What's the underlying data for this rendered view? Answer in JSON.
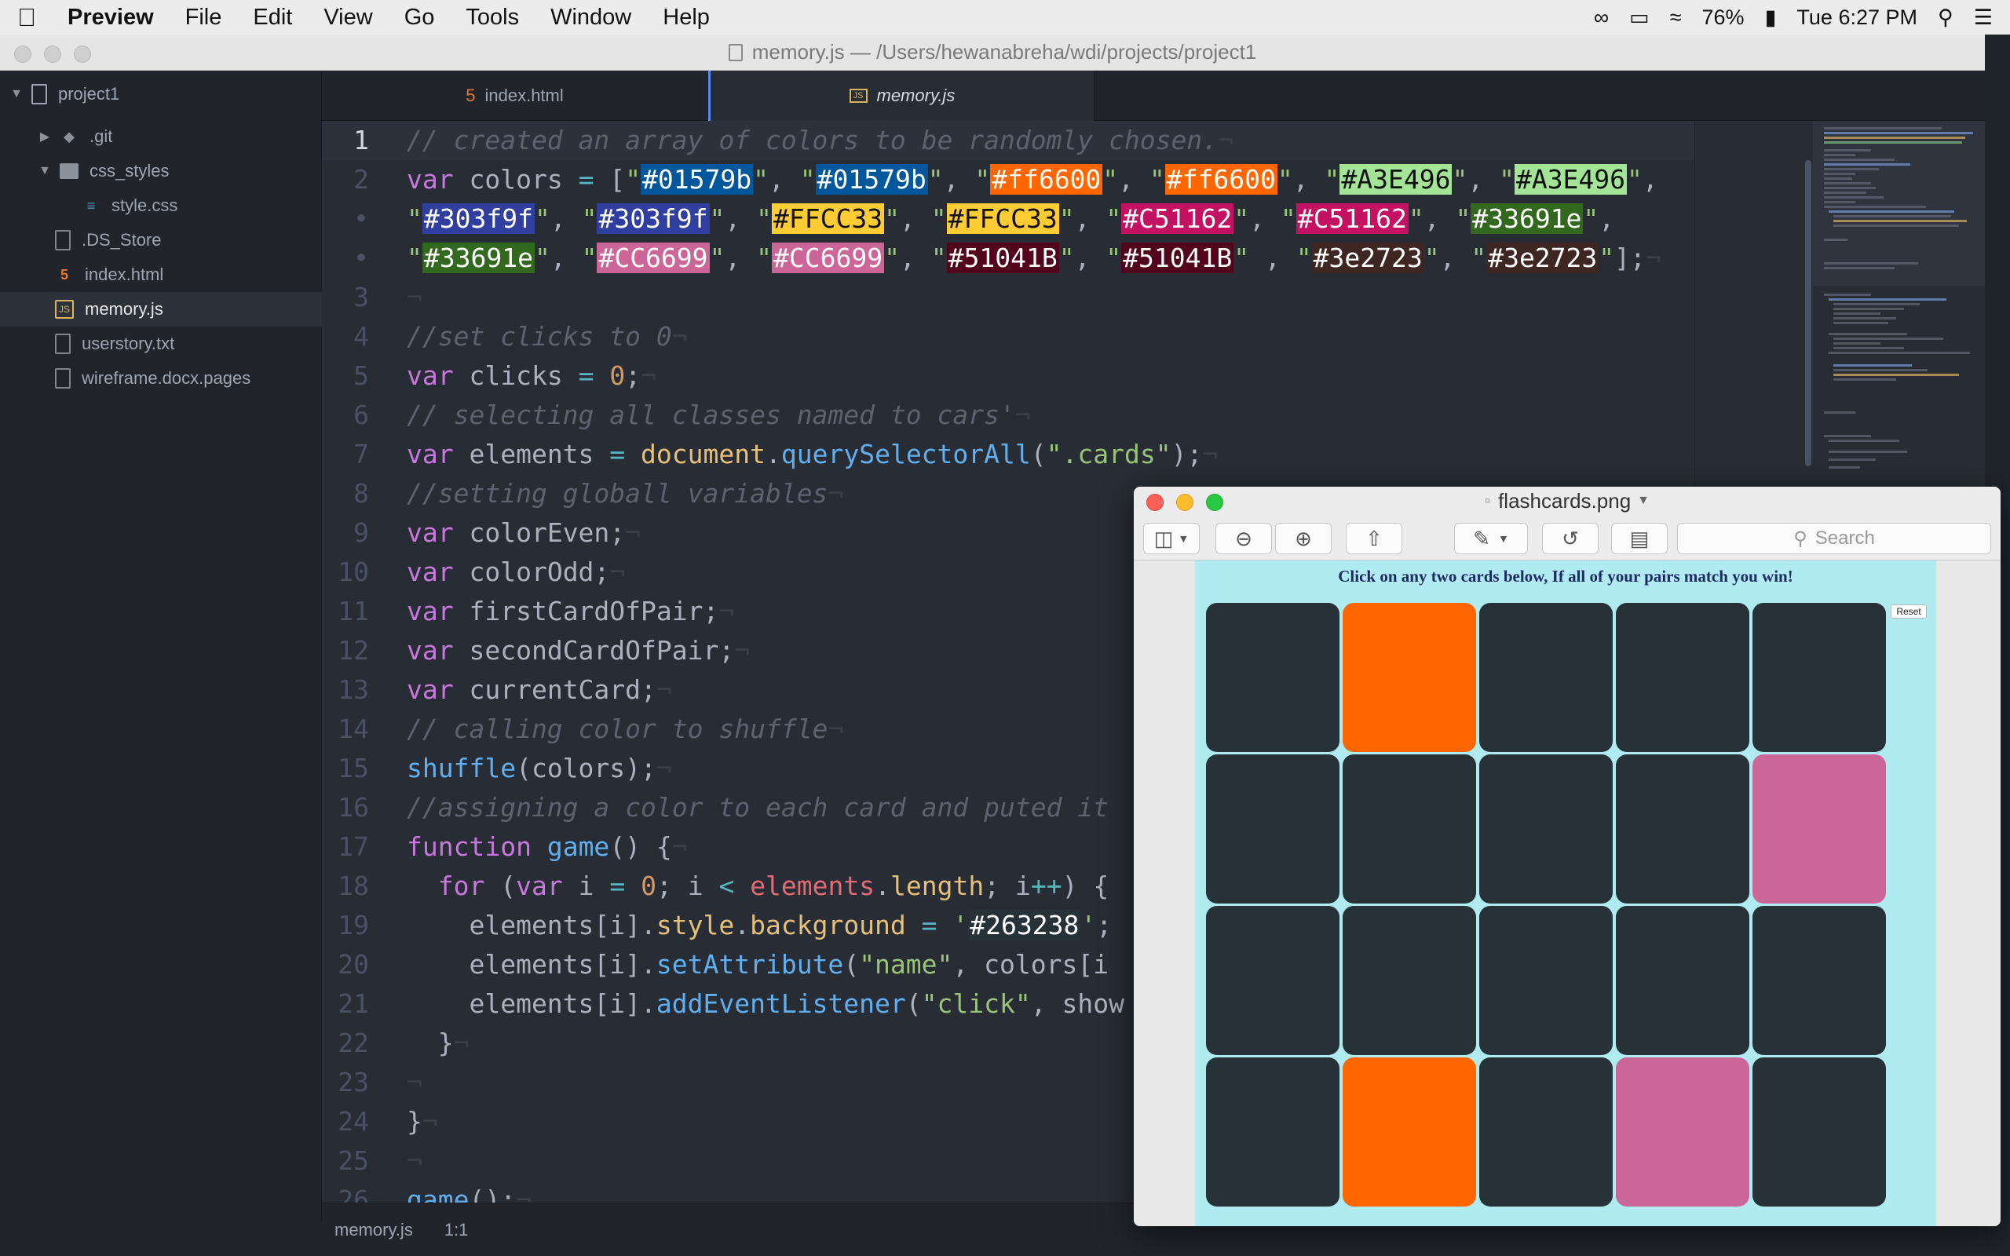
{
  "menubar": {
    "app": "Preview",
    "items": [
      "File",
      "Edit",
      "View",
      "Go",
      "Tools",
      "Window",
      "Help"
    ],
    "battery": "76%",
    "clock": "Tue 6:27 PM"
  },
  "editor": {
    "window_title": "memory.js — /Users/hewanabreha/wdi/projects/project1",
    "tree": {
      "root": "project1",
      "items": [
        ".git",
        "css_styles",
        "style.css",
        ".DS_Store",
        "index.html",
        "memory.js",
        "userstory.txt",
        "wireframe.docx.pages"
      ]
    },
    "tabs": [
      "index.html",
      "memory.js"
    ],
    "tab_icons": [
      "5",
      "JS"
    ],
    "line_numbers": [
      "1",
      "2",
      "•",
      "•",
      "3",
      "4",
      "5",
      "6",
      "7",
      "8",
      "9",
      "10",
      "11",
      "12",
      "13",
      "14",
      "15",
      "16",
      "17",
      "18",
      "19",
      "20",
      "21",
      "22",
      "23",
      "24",
      "25",
      "26"
    ],
    "status": {
      "file": "memory.js",
      "pos": "1:1"
    }
  },
  "code": {
    "l1": "// created an array of colors to be randomly chosen.",
    "c": [
      "#01579b",
      "#01579b",
      "#ff6600",
      "#ff6600",
      "#A3E496",
      "#A3E496",
      "#303f9f",
      "#303f9f",
      "#FFCC33",
      "#FFCC33",
      "#C51162",
      "#C51162",
      "#33691e",
      "#33691e",
      "#CC6699",
      "#CC6699",
      "#51041B",
      "#51041B",
      "#3e2723",
      "#3e2723"
    ],
    "l4": "//set clicks to 0",
    "l6": "// selecting all classes named to cars'",
    "l8": "//setting globall variables",
    "l14": "// calling color to shuffle",
    "l16": "//assigning a color to each card and puted it",
    "colorEven": "colorEven",
    "colorOdd": "colorOdd",
    "firstCardOfPair": "firstCardOfPair",
    "secondCardOfPair": "secondCardOfPair",
    "currentCard": "currentCard",
    "bg_color": "#263238"
  },
  "preview": {
    "title": "flashcards.png",
    "search_placeholder": "Search",
    "heading": "Click on any two cards below, If all of your pairs match you win!",
    "reset": "Reset",
    "card_rows": [
      [
        "#263238",
        "#ff6600",
        "#263238",
        "#263238",
        "#263238"
      ],
      [
        "#263238",
        "#263238",
        "#263238",
        "#263238",
        "#CC6699"
      ],
      [
        "#263238",
        "#263238",
        "#263238",
        "#263238",
        "#263238"
      ],
      [
        "#263238",
        "#ff6600",
        "#263238",
        "#CC6699",
        "#263238"
      ]
    ]
  },
  "colors": {
    "accent_tab": "#568af2",
    "page_bg": "#b1ebf2"
  }
}
